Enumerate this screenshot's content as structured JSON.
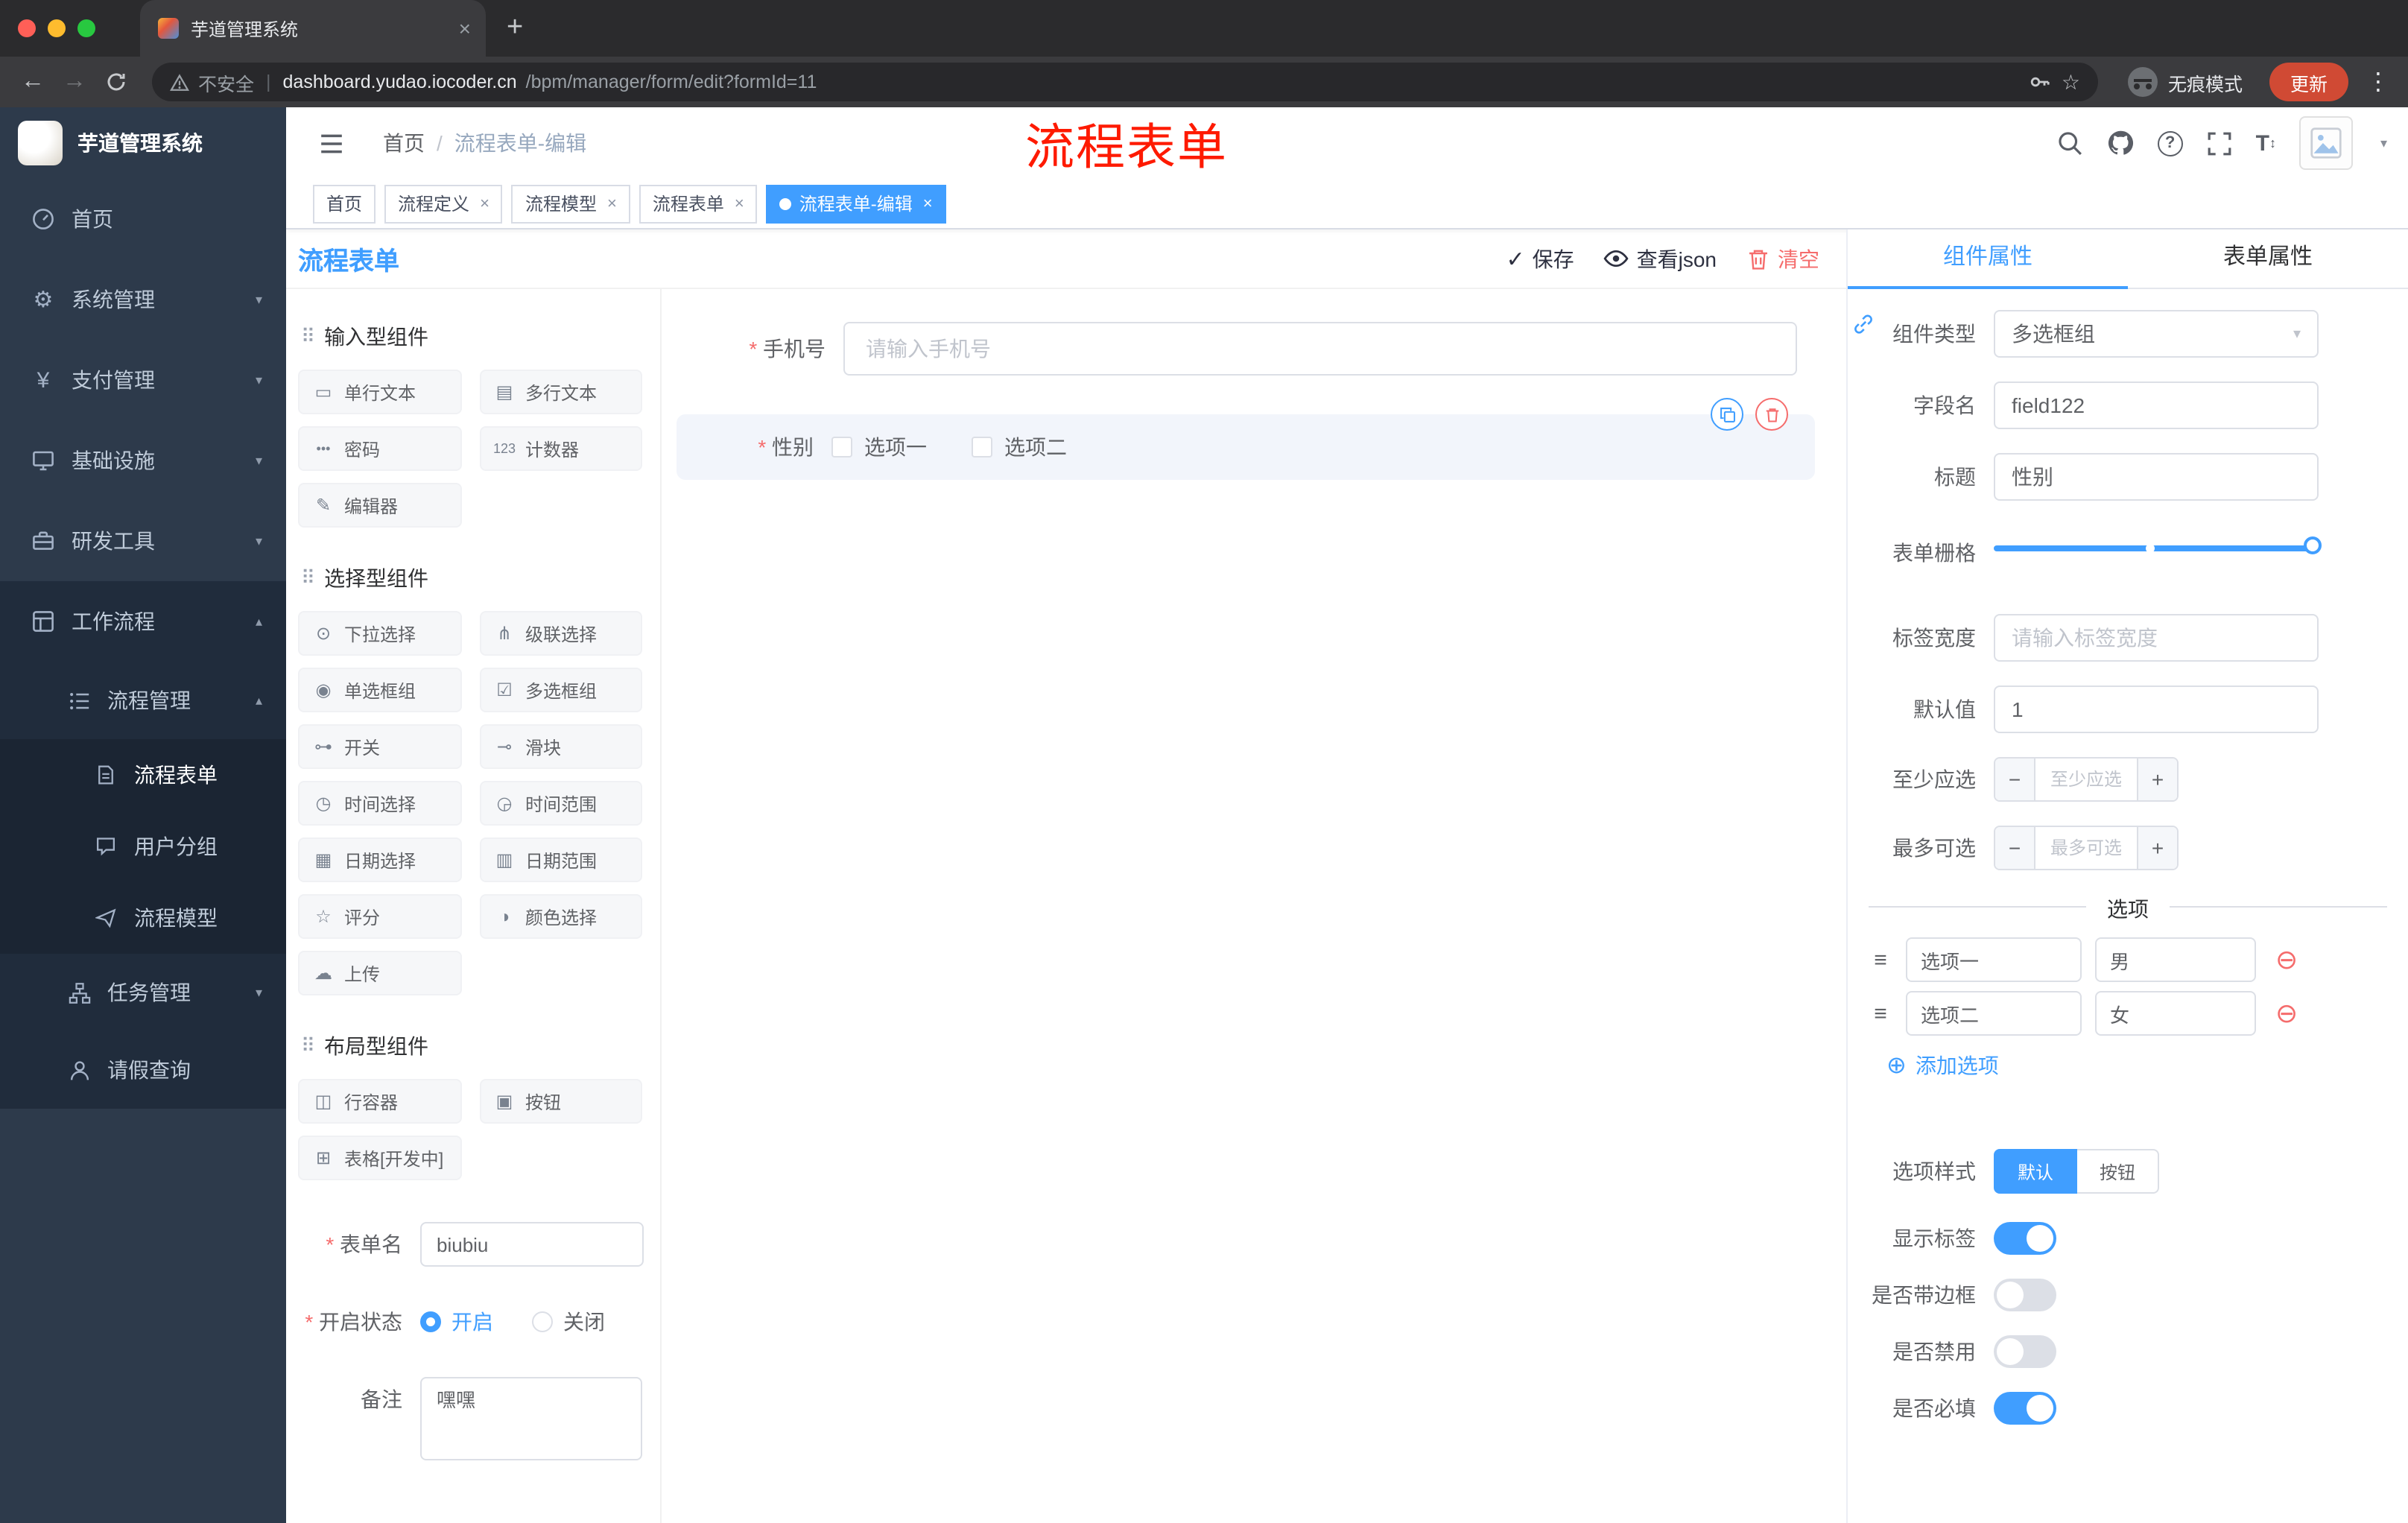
{
  "browser": {
    "tab_title": "芋道管理系统",
    "security_label": "不安全",
    "url_host": "dashboard.yudao.iocoder.cn",
    "url_path": "/bpm/manager/form/edit?formId=11",
    "incognito_label": "无痕模式",
    "update_label": "更新",
    "update_color": "#D04A34"
  },
  "sidebar": {
    "app_title": "芋道管理系统",
    "items": [
      {
        "label": "首页",
        "icon": "dashboard-icon"
      },
      {
        "label": "系统管理",
        "icon": "gear-icon"
      },
      {
        "label": "支付管理",
        "icon": "yen-icon"
      },
      {
        "label": "基础设施",
        "icon": "monitor-icon"
      },
      {
        "label": "研发工具",
        "icon": "toolbox-icon"
      },
      {
        "label": "工作流程",
        "icon": "workflow-icon"
      },
      {
        "label": "流程管理",
        "icon": "list-icon"
      },
      {
        "label": "流程表单",
        "icon": "document-icon"
      },
      {
        "label": "用户分组",
        "icon": "chat-icon"
      },
      {
        "label": "流程模型",
        "icon": "send-icon"
      },
      {
        "label": "任务管理",
        "icon": "tasks-icon"
      },
      {
        "label": "请假查询",
        "icon": "person-icon"
      }
    ]
  },
  "header": {
    "breadcrumb_home": "首页",
    "breadcrumb_current": "流程表单-编辑",
    "annotation": "流程表单"
  },
  "tags": [
    {
      "label": "首页"
    },
    {
      "label": "流程定义"
    },
    {
      "label": "流程模型"
    },
    {
      "label": "流程表单"
    },
    {
      "label": "流程表单-编辑"
    }
  ],
  "designer": {
    "title": "流程表单",
    "save_label": "保存",
    "view_json_label": "查看json",
    "clear_label": "清空",
    "palette": {
      "sections": [
        {
          "title": "输入型组件",
          "items": [
            {
              "label": "单行文本",
              "icon": "▭"
            },
            {
              "label": "多行文本",
              "icon": "▤"
            },
            {
              "label": "密码",
              "icon": "•••"
            },
            {
              "label": "计数器",
              "icon": "123"
            },
            {
              "label": "编辑器",
              "icon": "✎"
            }
          ]
        },
        {
          "title": "选择型组件",
          "items": [
            {
              "label": "下拉选择",
              "icon": "⊙"
            },
            {
              "label": "级联选择",
              "icon": "⋔"
            },
            {
              "label": "单选框组",
              "icon": "◉"
            },
            {
              "label": "多选框组",
              "icon": "☑"
            },
            {
              "label": "开关",
              "icon": "⊶"
            },
            {
              "label": "滑块",
              "icon": "⊸"
            },
            {
              "label": "时间选择",
              "icon": "◷"
            },
            {
              "label": "时间范围",
              "icon": "◶"
            },
            {
              "label": "日期选择",
              "icon": "▦"
            },
            {
              "label": "日期范围",
              "icon": "▥"
            },
            {
              "label": "评分",
              "icon": "☆"
            },
            {
              "label": "颜色选择",
              "icon": "◑"
            },
            {
              "label": "上传",
              "icon": "☁"
            }
          ]
        },
        {
          "title": "布局型组件",
          "items": [
            {
              "label": "行容器",
              "icon": "◫"
            },
            {
              "label": "按钮",
              "icon": "▣"
            },
            {
              "label": "表格[开发中]",
              "icon": "⊞"
            }
          ]
        }
      ]
    },
    "meta": {
      "form_name_label": "表单名",
      "form_name_value": "biubiu",
      "status_label": "开启状态",
      "status_on": "开启",
      "status_off": "关闭",
      "remark_label": "备注",
      "remark_value": "嘿嘿"
    },
    "canvas": {
      "phone_label": "手机号",
      "phone_placeholder": "请输入手机号",
      "gender_label": "性别",
      "gender_option1": "选项一",
      "gender_option2": "选项二"
    }
  },
  "props": {
    "tab_component": "组件属性",
    "tab_form": "表单属性",
    "component_type_label": "组件类型",
    "component_type_value": "多选框组",
    "field_name_label": "字段名",
    "field_name_value": "field122",
    "title_label": "标题",
    "title_value": "性别",
    "grid_label": "表单栅格",
    "label_width_label": "标签宽度",
    "label_width_placeholder": "请输入标签宽度",
    "default_label": "默认值",
    "default_value": "1",
    "min_label": "至少应选",
    "min_placeholder": "至少应选",
    "max_label": "最多可选",
    "max_placeholder": "最多可选",
    "options_title": "选项",
    "options": [
      {
        "label": "选项一",
        "value": "男"
      },
      {
        "label": "选项二",
        "value": "女"
      }
    ],
    "add_option_label": "添加选项",
    "option_style_label": "选项样式",
    "option_style_default": "默认",
    "option_style_button": "按钮",
    "toggle_show_label": "显示标签",
    "toggle_border_label": "是否带边框",
    "toggle_disabled_label": "是否禁用",
    "toggle_required_label": "是否必填",
    "accent_color": "#409EFF",
    "danger_color": "#F56C6C"
  }
}
